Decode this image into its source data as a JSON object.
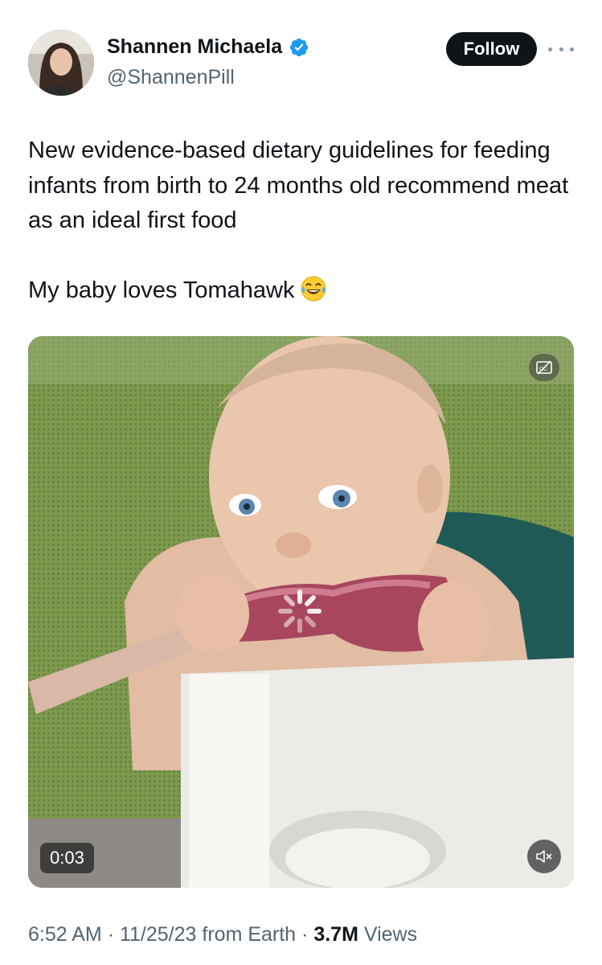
{
  "author": {
    "display_name": "Shannen Michaela",
    "handle": "@ShannenPill",
    "verified": true,
    "avatar_icon": "profile-photo"
  },
  "actions": {
    "follow_label": "Follow",
    "more_icon": "more-dots-icon"
  },
  "tweet": {
    "paragraph1": "New evidence-based dietary guidelines for feeding infants from birth to 24 months old recommend meat as an ideal first food",
    "paragraph2": "My baby loves Tomahawk",
    "emoji": "tears-of-joy-emoji"
  },
  "media": {
    "type": "video",
    "timestamp": "0:03",
    "captions_icon": "captions-off-icon",
    "mute_icon": "muted-speaker-icon",
    "loading_icon": "loading-spinner-icon"
  },
  "meta": {
    "time": "6:52 AM",
    "date": "11/25/23",
    "source": "from Earth",
    "views_count": "3.7M",
    "views_label": "Views",
    "separator": "·"
  },
  "colors": {
    "text_primary": "#0f1419",
    "text_secondary": "#536471",
    "verified_blue": "#1d9bf0",
    "follow_bg": "#0f1419"
  }
}
